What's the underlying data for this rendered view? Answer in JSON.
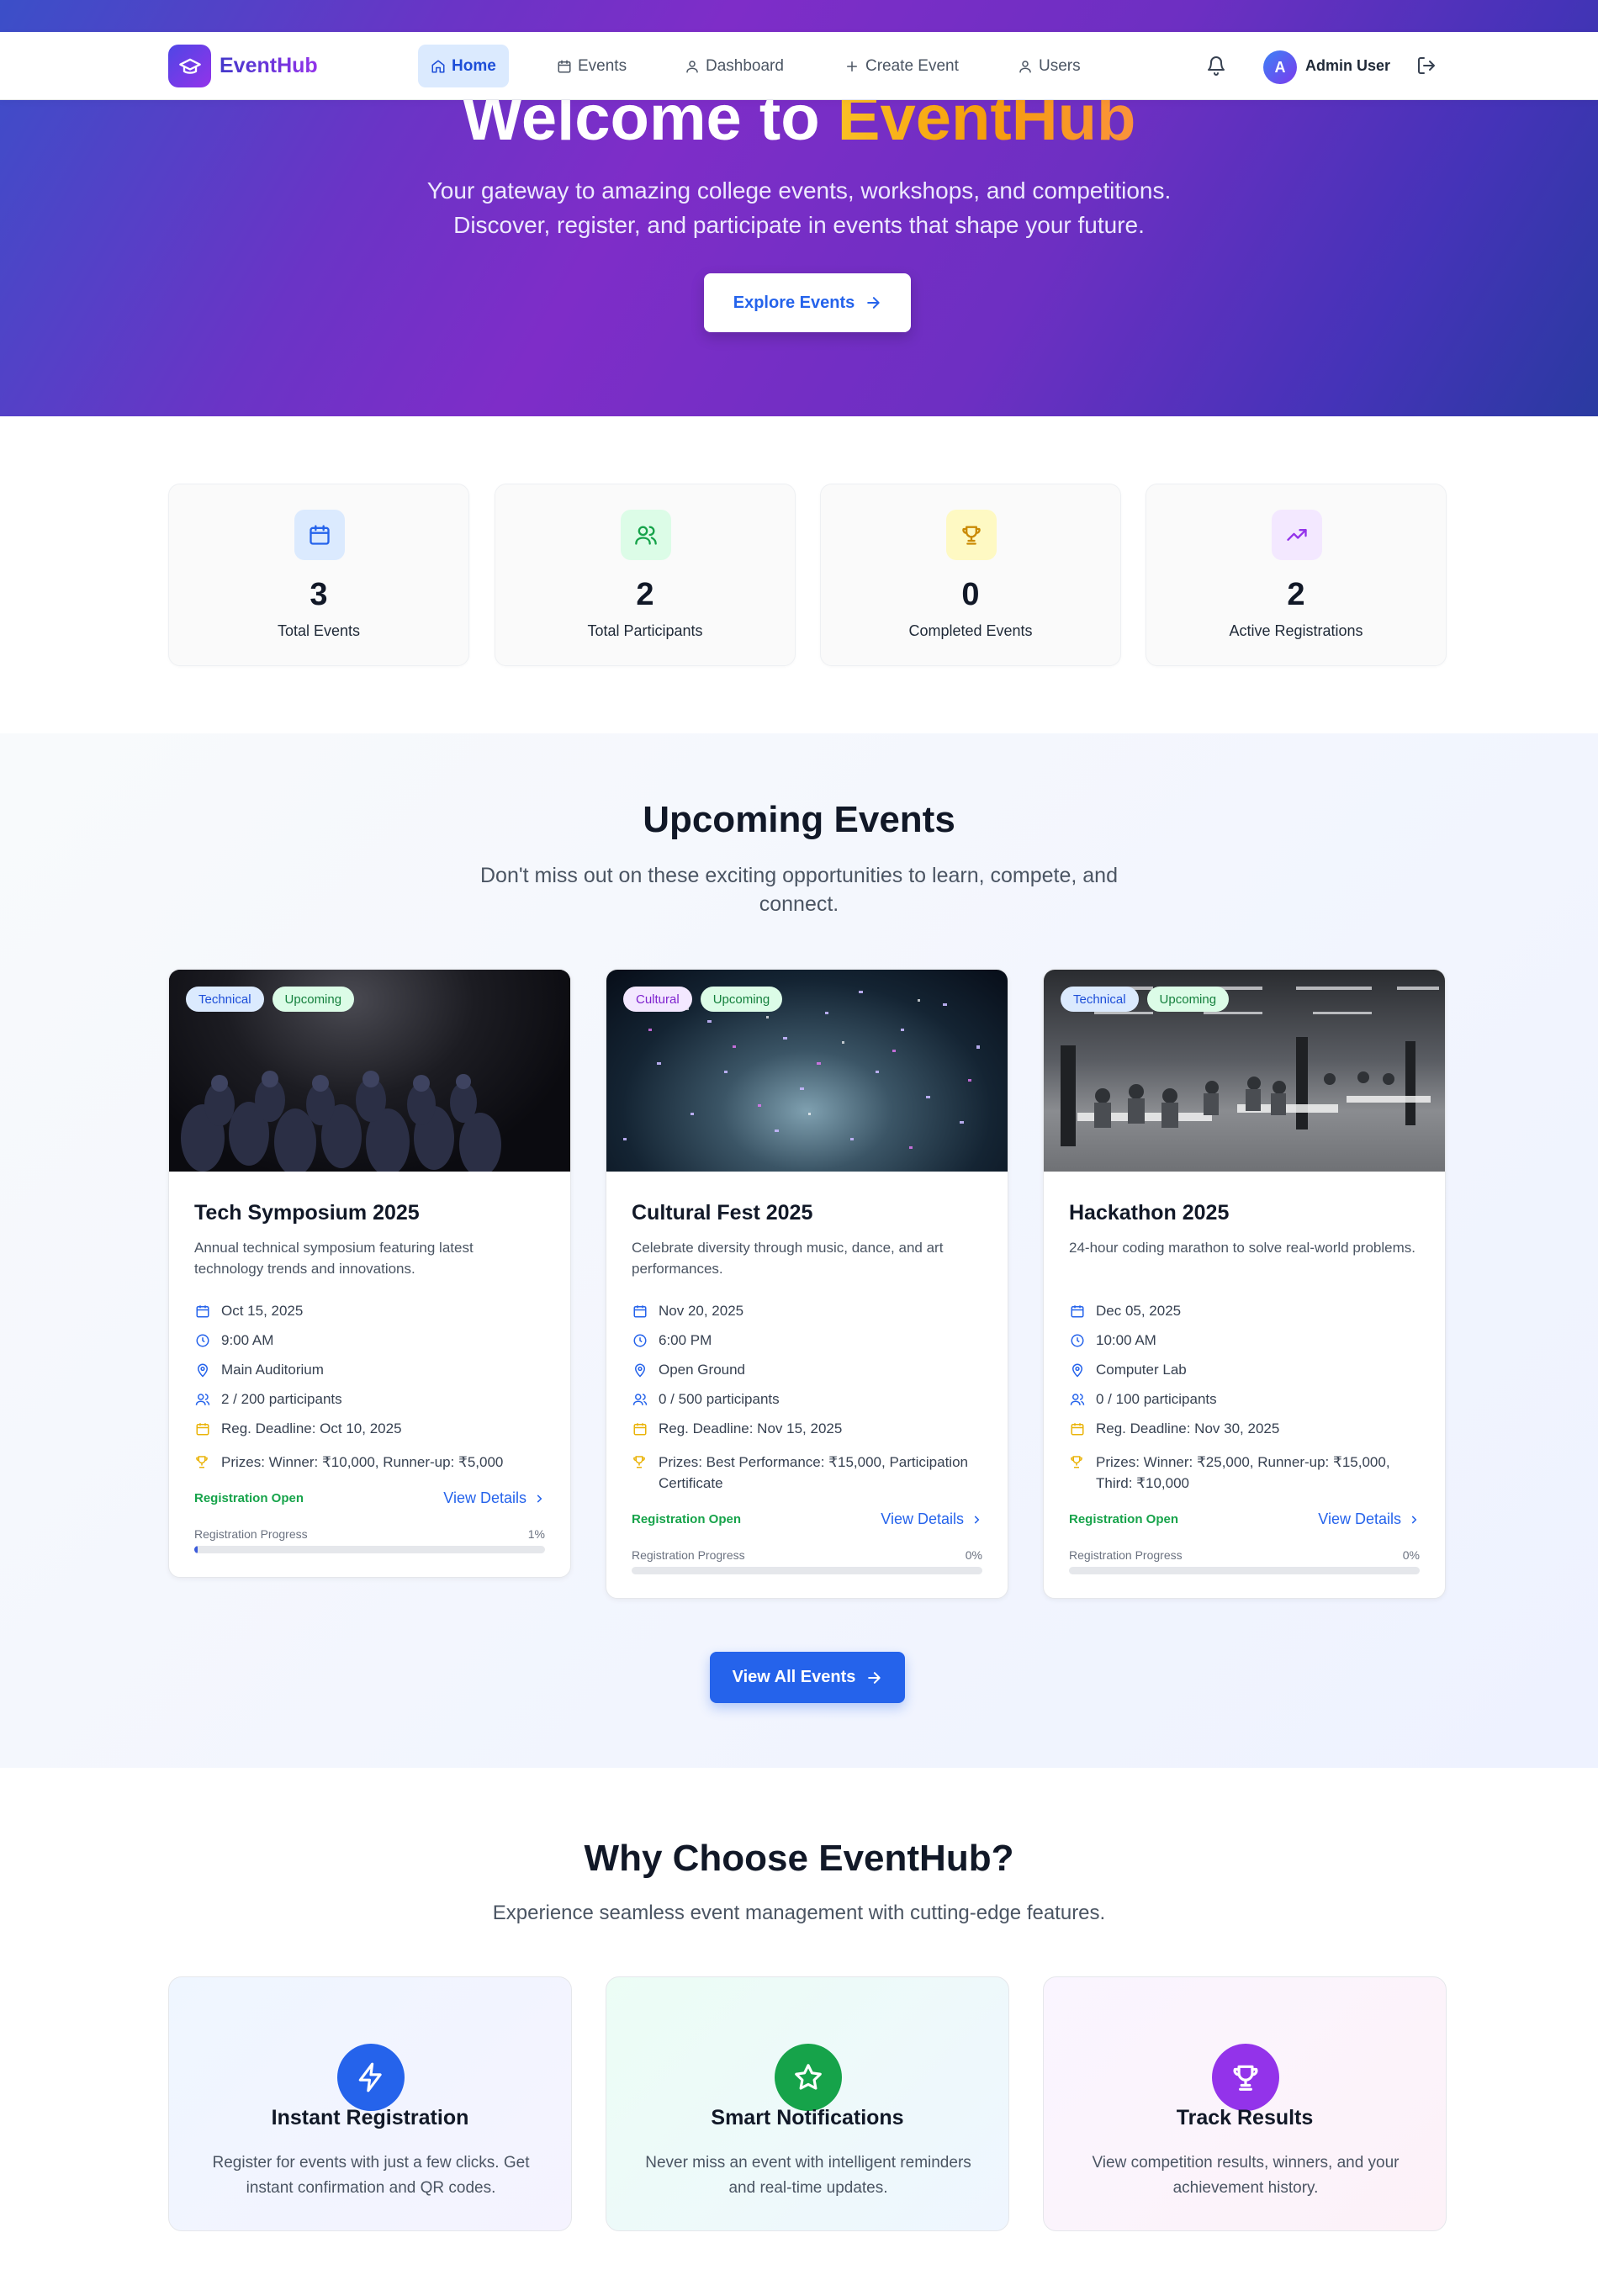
{
  "nav": {
    "brand": "EventHub",
    "items": [
      {
        "label": "Home",
        "icon": "home-icon",
        "active": true
      },
      {
        "label": "Events",
        "icon": "calendar-icon",
        "active": false
      },
      {
        "label": "Dashboard",
        "icon": "user-icon",
        "active": false
      },
      {
        "label": "Create Event",
        "icon": "plus-icon",
        "active": false
      },
      {
        "label": "Users",
        "icon": "user-icon",
        "active": false
      }
    ],
    "user": {
      "initial": "A",
      "name": "Admin User"
    }
  },
  "hero": {
    "title_prefix": "Welcome to ",
    "title_accent": "EventHub",
    "subtitle_line1": "Your gateway to amazing college events, workshops, and competitions.",
    "subtitle_line2": "Discover, register, and participate in events that shape your future.",
    "cta": "Explore Events"
  },
  "stats": [
    {
      "value": "3",
      "label": "Total Events",
      "icon": "calendar-icon",
      "color": "#2563eb",
      "bg": "#dbeafe"
    },
    {
      "value": "2",
      "label": "Total Participants",
      "icon": "users-icon",
      "color": "#16a34a",
      "bg": "#dcfce7"
    },
    {
      "value": "0",
      "label": "Completed Events",
      "icon": "trophy-icon",
      "color": "#ca8a04",
      "bg": "#fef9c3"
    },
    {
      "value": "2",
      "label": "Active Registrations",
      "icon": "trending-up-icon",
      "color": "#9333ea",
      "bg": "#f3e8ff"
    }
  ],
  "upcoming": {
    "title": "Upcoming Events",
    "subtitle_line1": "Don't miss out on these exciting opportunities to learn, compete, and",
    "subtitle_line2": "connect.",
    "view_all": "View All Events",
    "events": [
      {
        "category": "Technical",
        "status": "Upcoming",
        "title": "Tech Symposium 2025",
        "description": "Annual technical symposium featuring latest technology trends and innovations.",
        "date": "Oct 15, 2025",
        "time": "9:00 AM",
        "venue": "Main Auditorium",
        "participants": "2 / 200 participants",
        "deadline": "Reg. Deadline: Oct 10, 2025",
        "prizes": "Prizes: Winner: ₹10,000, Runner-up: ₹5,000",
        "registration": "Registration Open",
        "view": "View Details",
        "progress_label": "Registration Progress",
        "progress_text": "1%",
        "progress": 1
      },
      {
        "category": "Cultural",
        "status": "Upcoming",
        "title": "Cultural Fest 2025",
        "description": "Celebrate diversity through music, dance, and art performances.",
        "date": "Nov 20, 2025",
        "time": "6:00 PM",
        "venue": "Open Ground",
        "participants": "0 / 500 participants",
        "deadline": "Reg. Deadline: Nov 15, 2025",
        "prizes": "Prizes: Best Performance: ₹15,000, Participation Certificate",
        "registration": "Registration Open",
        "view": "View Details",
        "progress_label": "Registration Progress",
        "progress_text": "0%",
        "progress": 0
      },
      {
        "category": "Technical",
        "status": "Upcoming",
        "title": "Hackathon 2025",
        "description": "24-hour coding marathon to solve real-world problems.",
        "date": "Dec 05, 2025",
        "time": "10:00 AM",
        "venue": "Computer Lab",
        "participants": "0 / 100 participants",
        "deadline": "Reg. Deadline: Nov 30, 2025",
        "prizes": "Prizes: Winner: ₹25,000, Runner-up: ₹15,000, Third: ₹10,000",
        "registration": "Registration Open",
        "view": "View Details",
        "progress_label": "Registration Progress",
        "progress_text": "0%",
        "progress": 0
      }
    ]
  },
  "features": {
    "title": "Why Choose EventHub?",
    "subtitle": "Experience seamless event management with cutting-edge features.",
    "items": [
      {
        "title": "Instant Registration",
        "description": "Register for events with just a few clicks. Get instant confirmation and QR codes.",
        "icon": "zap-icon",
        "color": "#2563eb"
      },
      {
        "title": "Smart Notifications",
        "description": "Never miss an event with intelligent reminders and real-time updates.",
        "icon": "star-icon",
        "color": "#16a34a"
      },
      {
        "title": "Track Results",
        "description": "View competition results, winners, and your achievement history.",
        "icon": "trophy-icon",
        "color": "#9333ea"
      }
    ]
  }
}
